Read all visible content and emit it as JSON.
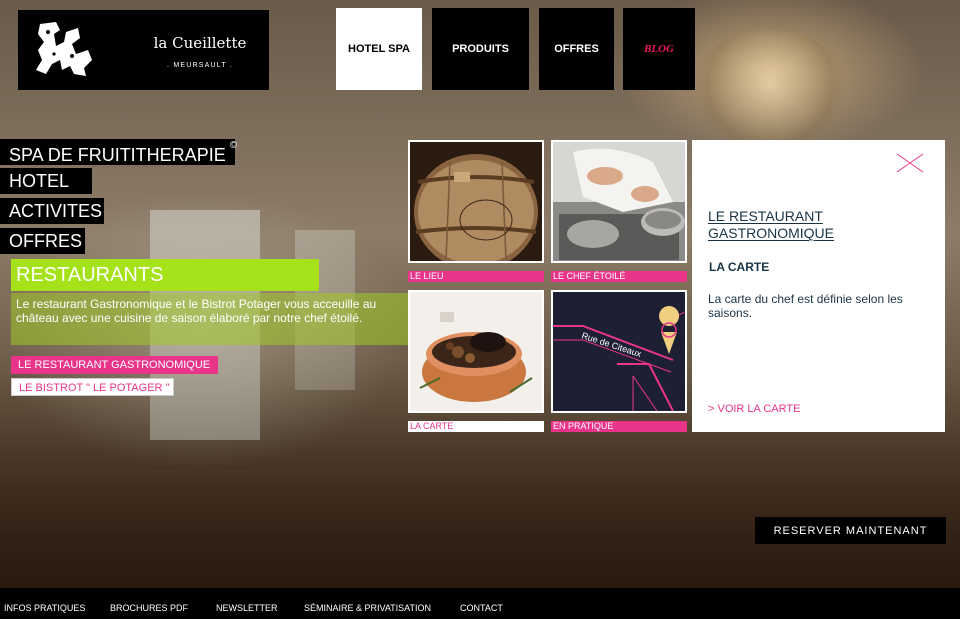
{
  "brand": {
    "name": "la Cueillette",
    "subtitle": ". MEURSAULT ."
  },
  "top_nav": [
    {
      "label": "HOTEL SPA",
      "active": true
    },
    {
      "label": "PRODUITS",
      "active": false
    },
    {
      "label": "OFFRES",
      "active": false
    },
    {
      "label": "BLOG",
      "active": false
    }
  ],
  "left_menu": {
    "spa": "SPA DE FRUITITHERAPIE",
    "spa_mark": "©",
    "hotel": "HOTEL",
    "activites": "ACTIVITES",
    "offres": "OFFRES"
  },
  "restaurants": {
    "title": "RESTAURANTS",
    "description": "Le restaurant Gastronomique et le Bistrot Potager vous acceuille au château avec une cuisine de saison élaboré par notre chef étoilé.",
    "link_gastronomique": "LE RESTAURANT GASTRONOMIQUE",
    "link_bistrot": "LE BISTROT \" LE POTAGER \""
  },
  "tiles": [
    {
      "label": "LE LIEU",
      "icon": "barrel-photo"
    },
    {
      "label": "LE CHEF ÉTOILÉ",
      "icon": "chef-photo"
    },
    {
      "label": "LA CARTE",
      "icon": "dish-photo"
    },
    {
      "label": "EN PRATIQUE",
      "icon": "map-photo"
    }
  ],
  "map": {
    "street": "Rue de Citeaux"
  },
  "panel": {
    "title": "LE RESTAURANT GASTRONOMIQUE",
    "subtitle": "LA CARTE",
    "text": "La carte du chef est définie selon les saisons.",
    "link": "> VOIR LA CARTE"
  },
  "reserve_label": "RESERVER MAINTENANT",
  "footer": [
    "INFOS PRATIQUES",
    "BROCHURES PDF",
    "NEWSLETTER",
    "SÉMINAIRE & PRIVATISATION",
    "CONTACT"
  ],
  "colors": {
    "accent_pink": "#e8358a",
    "accent_green": "#a5e219",
    "blog_red": "#e8175d",
    "panel_text": "#1a3446"
  }
}
